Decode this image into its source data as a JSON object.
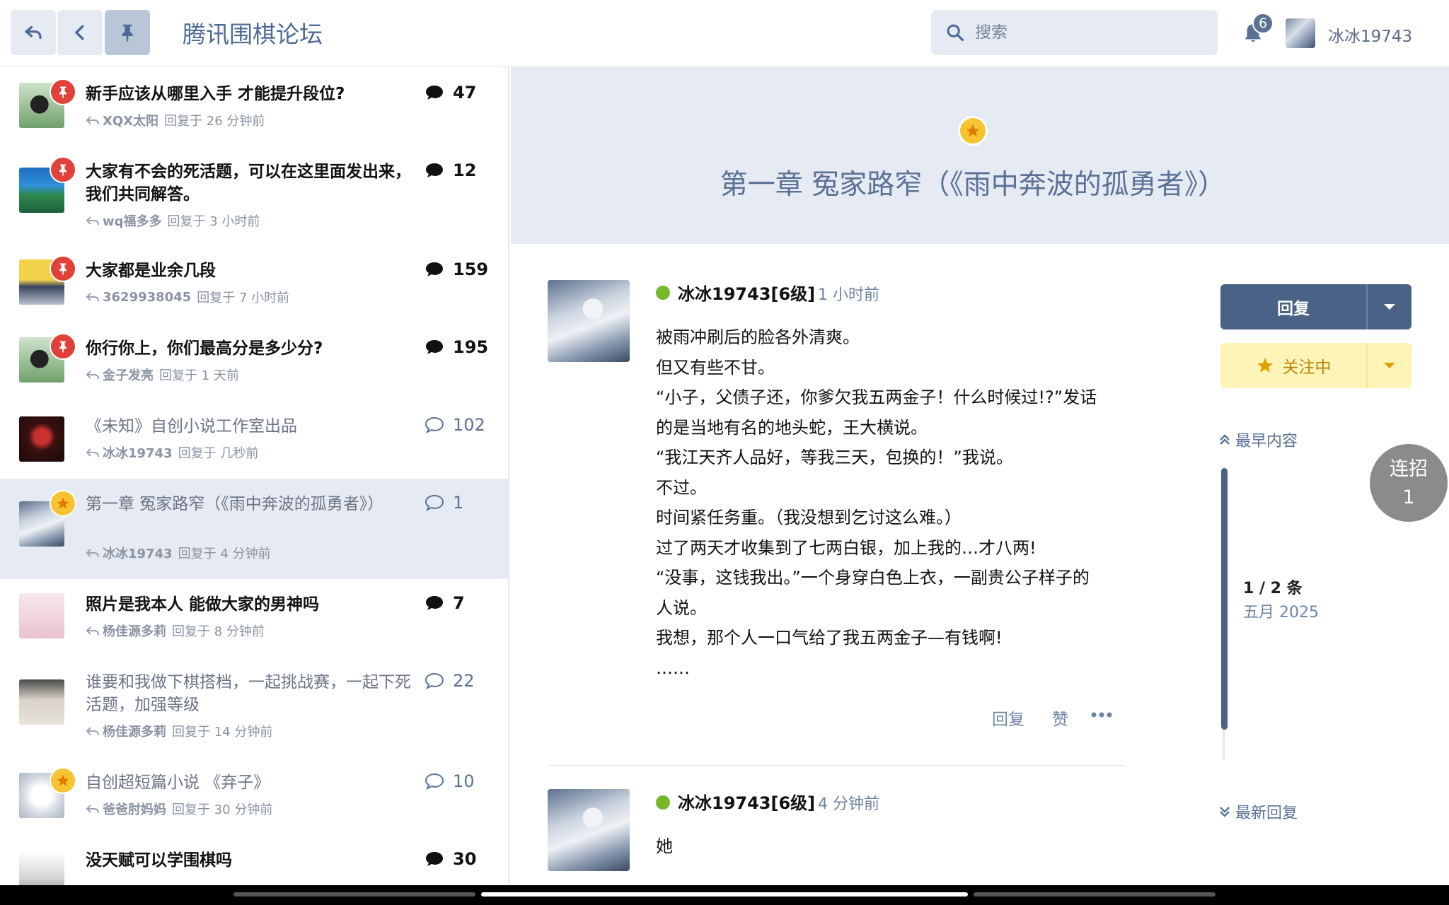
{
  "header": {
    "forum_title": "腾讯围棋论坛",
    "search_placeholder": "搜索",
    "notification_count": "6",
    "username": "冰冰19743",
    "buttons": [
      "back-arrow-icon",
      "chevron-left-icon",
      "pin-icon"
    ]
  },
  "topics": [
    {
      "title": "新手应该从哪里入手 才能提升段位?",
      "user": "XQX太阳",
      "reply_time": "回复于 26 分钟前",
      "count": "47",
      "badge": "pin",
      "unread": true
    },
    {
      "title": "大家有不会的死活题，可以在这里面发出来，我们共同解答。",
      "user": "wq福多多",
      "reply_time": "回复于 3 小时前",
      "count": "12",
      "badge": "pin",
      "unread": true
    },
    {
      "title": "大家都是业余几段",
      "user": "3629938045",
      "reply_time": "回复于 7 小时前",
      "count": "159",
      "badge": "pin",
      "unread": true
    },
    {
      "title": "你行你上，你们最高分是多少分?",
      "user": "金子发亮",
      "reply_time": "回复于 1 天前",
      "count": "195",
      "badge": "pin",
      "unread": true
    },
    {
      "title": "《未知》自创小说工作室出品",
      "user": "冰冰19743",
      "reply_time": "回复于 几秒前",
      "count": "102",
      "badge": "",
      "unread": false
    },
    {
      "title": "第一章 冤家路窄（《雨中奔波的孤勇者》）",
      "user": "冰冰19743",
      "reply_time": "回复于 4 分钟前",
      "count": "1",
      "badge": "star",
      "unread": false
    },
    {
      "title": "照片是我本人 能做大家的男神吗",
      "user": "杨佳源多莉",
      "reply_time": "回复于 8 分钟前",
      "count": "7",
      "badge": "",
      "unread": true
    },
    {
      "title": "谁要和我做下棋搭档，一起挑战赛，一起下死活题，加强等级",
      "user": "杨佳源多莉",
      "reply_time": "回复于 14 分钟前",
      "count": "22",
      "badge": "",
      "unread": false
    },
    {
      "title": "自创超短篇小说 《弃子》",
      "user": "爸爸肘妈妈",
      "reply_time": "回复于 30 分钟前",
      "count": "10",
      "badge": "star",
      "unread": false
    },
    {
      "title": "没天赋可以学围棋吗",
      "user": "",
      "reply_time": "",
      "count": "30",
      "badge": "",
      "unread": true
    }
  ],
  "topic": {
    "title": "第一章 冤家路窄（《雨中奔波的孤勇者》）"
  },
  "posts": [
    {
      "user": "冰冰19743[6级]",
      "time": "1 小时前",
      "lines": [
        "被雨冲刷后的脸各外清爽。",
        "但又有些不甘。",
        "“小子，父债子还，你爹欠我五两金子！什么时候过!?”发话",
        "的是当地有名的地头蛇，王大横说。",
        "“我江天齐人品好，等我三天，包换的！”我说。",
        "不过。",
        "时间紧任务重。（我没想到乞讨这么难。）",
        "过了两天才收集到了七两白银，加上我的…才八两!",
        "“没事，这钱我出。”一个身穿白色上衣，一副贵公子样子的",
        "人说。",
        "我想，那个人一口气给了我五两金子—有钱啊!",
        "……"
      ],
      "actions": {
        "reply": "回复",
        "like": "赞"
      }
    },
    {
      "user": "冰冰19743[6级]",
      "time": "4 分钟前",
      "lines": [
        "她"
      ]
    }
  ],
  "sidebar": {
    "reply_button": "回复",
    "watch_button": "关注中",
    "earliest": "最早内容",
    "position": "1 / 2 条",
    "date": "五月 2025",
    "latest": "最新回复"
  },
  "combo": {
    "label": "连招",
    "count": "1"
  },
  "colors": {
    "accent": "#4a6285",
    "header_bg": "#e6ebf3",
    "pin_red": "#e0423a",
    "star_yellow": "#f5c430",
    "online_green": "#76b82a",
    "watch_bg": "#fff4b8"
  }
}
